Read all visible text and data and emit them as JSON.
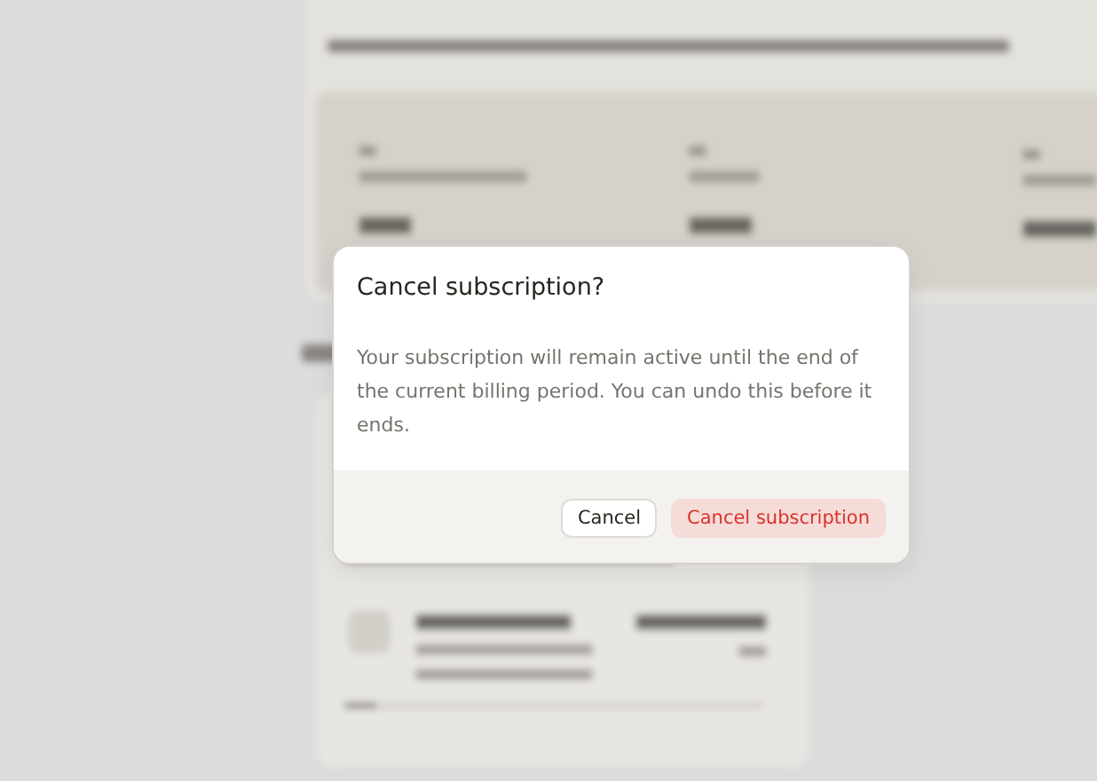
{
  "dialog": {
    "title": "Cancel subscription?",
    "message": "Your subscription will remain active until the end of the current billing period. You can undo this before it ends.",
    "buttons": [
      {
        "label": "Cancel",
        "kind": "secondary"
      },
      {
        "label": "Cancel subscription",
        "kind": "danger"
      }
    ]
  }
}
